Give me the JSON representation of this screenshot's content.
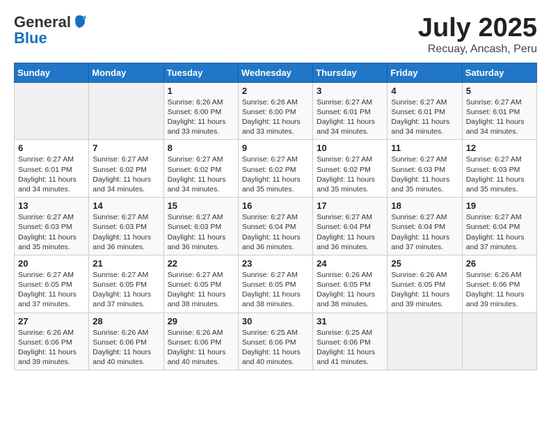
{
  "header": {
    "logo_general": "General",
    "logo_blue": "Blue",
    "month_title": "July 2025",
    "location": "Recuay, Ancash, Peru"
  },
  "weekdays": [
    "Sunday",
    "Monday",
    "Tuesday",
    "Wednesday",
    "Thursday",
    "Friday",
    "Saturday"
  ],
  "weeks": [
    [
      {
        "day": "",
        "info": ""
      },
      {
        "day": "",
        "info": ""
      },
      {
        "day": "1",
        "info": "Sunrise: 6:26 AM\nSunset: 6:00 PM\nDaylight: 11 hours and 33 minutes."
      },
      {
        "day": "2",
        "info": "Sunrise: 6:26 AM\nSunset: 6:00 PM\nDaylight: 11 hours and 33 minutes."
      },
      {
        "day": "3",
        "info": "Sunrise: 6:27 AM\nSunset: 6:01 PM\nDaylight: 11 hours and 34 minutes."
      },
      {
        "day": "4",
        "info": "Sunrise: 6:27 AM\nSunset: 6:01 PM\nDaylight: 11 hours and 34 minutes."
      },
      {
        "day": "5",
        "info": "Sunrise: 6:27 AM\nSunset: 6:01 PM\nDaylight: 11 hours and 34 minutes."
      }
    ],
    [
      {
        "day": "6",
        "info": "Sunrise: 6:27 AM\nSunset: 6:01 PM\nDaylight: 11 hours and 34 minutes."
      },
      {
        "day": "7",
        "info": "Sunrise: 6:27 AM\nSunset: 6:02 PM\nDaylight: 11 hours and 34 minutes."
      },
      {
        "day": "8",
        "info": "Sunrise: 6:27 AM\nSunset: 6:02 PM\nDaylight: 11 hours and 34 minutes."
      },
      {
        "day": "9",
        "info": "Sunrise: 6:27 AM\nSunset: 6:02 PM\nDaylight: 11 hours and 35 minutes."
      },
      {
        "day": "10",
        "info": "Sunrise: 6:27 AM\nSunset: 6:02 PM\nDaylight: 11 hours and 35 minutes."
      },
      {
        "day": "11",
        "info": "Sunrise: 6:27 AM\nSunset: 6:03 PM\nDaylight: 11 hours and 35 minutes."
      },
      {
        "day": "12",
        "info": "Sunrise: 6:27 AM\nSunset: 6:03 PM\nDaylight: 11 hours and 35 minutes."
      }
    ],
    [
      {
        "day": "13",
        "info": "Sunrise: 6:27 AM\nSunset: 6:03 PM\nDaylight: 11 hours and 35 minutes."
      },
      {
        "day": "14",
        "info": "Sunrise: 6:27 AM\nSunset: 6:03 PM\nDaylight: 11 hours and 36 minutes."
      },
      {
        "day": "15",
        "info": "Sunrise: 6:27 AM\nSunset: 6:03 PM\nDaylight: 11 hours and 36 minutes."
      },
      {
        "day": "16",
        "info": "Sunrise: 6:27 AM\nSunset: 6:04 PM\nDaylight: 11 hours and 36 minutes."
      },
      {
        "day": "17",
        "info": "Sunrise: 6:27 AM\nSunset: 6:04 PM\nDaylight: 11 hours and 36 minutes."
      },
      {
        "day": "18",
        "info": "Sunrise: 6:27 AM\nSunset: 6:04 PM\nDaylight: 11 hours and 37 minutes."
      },
      {
        "day": "19",
        "info": "Sunrise: 6:27 AM\nSunset: 6:04 PM\nDaylight: 11 hours and 37 minutes."
      }
    ],
    [
      {
        "day": "20",
        "info": "Sunrise: 6:27 AM\nSunset: 6:05 PM\nDaylight: 11 hours and 37 minutes."
      },
      {
        "day": "21",
        "info": "Sunrise: 6:27 AM\nSunset: 6:05 PM\nDaylight: 11 hours and 37 minutes."
      },
      {
        "day": "22",
        "info": "Sunrise: 6:27 AM\nSunset: 6:05 PM\nDaylight: 11 hours and 38 minutes."
      },
      {
        "day": "23",
        "info": "Sunrise: 6:27 AM\nSunset: 6:05 PM\nDaylight: 11 hours and 38 minutes."
      },
      {
        "day": "24",
        "info": "Sunrise: 6:26 AM\nSunset: 6:05 PM\nDaylight: 11 hours and 38 minutes."
      },
      {
        "day": "25",
        "info": "Sunrise: 6:26 AM\nSunset: 6:05 PM\nDaylight: 11 hours and 39 minutes."
      },
      {
        "day": "26",
        "info": "Sunrise: 6:26 AM\nSunset: 6:06 PM\nDaylight: 11 hours and 39 minutes."
      }
    ],
    [
      {
        "day": "27",
        "info": "Sunrise: 6:26 AM\nSunset: 6:06 PM\nDaylight: 11 hours and 39 minutes."
      },
      {
        "day": "28",
        "info": "Sunrise: 6:26 AM\nSunset: 6:06 PM\nDaylight: 11 hours and 40 minutes."
      },
      {
        "day": "29",
        "info": "Sunrise: 6:26 AM\nSunset: 6:06 PM\nDaylight: 11 hours and 40 minutes."
      },
      {
        "day": "30",
        "info": "Sunrise: 6:25 AM\nSunset: 6:06 PM\nDaylight: 11 hours and 40 minutes."
      },
      {
        "day": "31",
        "info": "Sunrise: 6:25 AM\nSunset: 6:06 PM\nDaylight: 11 hours and 41 minutes."
      },
      {
        "day": "",
        "info": ""
      },
      {
        "day": "",
        "info": ""
      }
    ]
  ]
}
